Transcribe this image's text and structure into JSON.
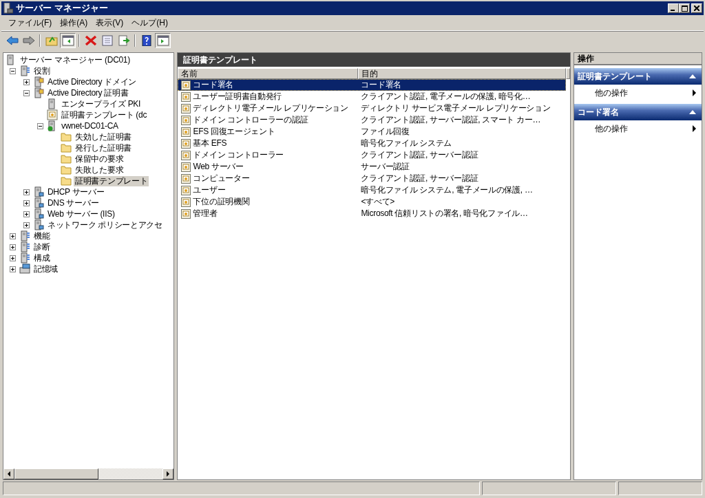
{
  "window": {
    "title": "サーバー マネージャー"
  },
  "menu": [
    "ファイル(F)",
    "操作(A)",
    "表示(V)",
    "ヘルプ(H)"
  ],
  "toolbar": [
    {
      "kind": "back"
    },
    {
      "kind": "forward"
    },
    {
      "kind": "separator"
    },
    {
      "kind": "up"
    },
    {
      "kind": "tree-toggle",
      "pressed": true
    },
    {
      "kind": "separator"
    },
    {
      "kind": "delete"
    },
    {
      "kind": "properties"
    },
    {
      "kind": "export"
    },
    {
      "kind": "separator"
    },
    {
      "kind": "help"
    },
    {
      "kind": "action-toggle",
      "pressed": true
    }
  ],
  "tree": [
    {
      "label": "サーバー マネージャー (DC01)",
      "kind": "server",
      "selected": false,
      "expanded": true,
      "children": [
        {
          "label": "役割",
          "kind": "roles",
          "selected": false,
          "expanded": true,
          "children": [
            {
              "label": "Active Directory ドメイン",
              "kind": "ad",
              "selected": false,
              "expanded": false
            },
            {
              "label": "Active Directory 証明書",
              "kind": "ad",
              "selected": false,
              "expanded": true,
              "children": [
                {
                  "label": "エンタープライズ PKI",
                  "kind": "server",
                  "selected": false
                },
                {
                  "label": "証明書テンプレート (dc",
                  "kind": "certificate",
                  "selected": false
                },
                {
                  "label": "vwnet-DC01-CA",
                  "kind": "ca",
                  "selected": false,
                  "expanded": true,
                  "children": [
                    {
                      "label": "失効した証明書",
                      "kind": "folder",
                      "selected": false
                    },
                    {
                      "label": "発行した証明書",
                      "kind": "folder",
                      "selected": false
                    },
                    {
                      "label": "保留中の要求",
                      "kind": "folder",
                      "selected": false
                    },
                    {
                      "label": "失敗した要求",
                      "kind": "folder",
                      "selected": false
                    },
                    {
                      "label": "証明書テンプレート",
                      "kind": "folder",
                      "selected": true
                    }
                  ]
                }
              ]
            },
            {
              "label": "DHCP サーバー",
              "kind": "network",
              "selected": false,
              "expanded": false
            },
            {
              "label": "DNS サーバー",
              "kind": "network",
              "selected": false,
              "expanded": false
            },
            {
              "label": "Web サーバー (IIS)",
              "kind": "network",
              "selected": false,
              "expanded": false
            },
            {
              "label": "ネットワーク ポリシーとアクセ",
              "kind": "network",
              "selected": false,
              "expanded": false
            }
          ]
        },
        {
          "label": "機能",
          "kind": "roles",
          "selected": false,
          "expanded": false
        },
        {
          "label": "診断",
          "kind": "roles",
          "selected": false,
          "expanded": false
        },
        {
          "label": "構成",
          "kind": "roles",
          "selected": false,
          "expanded": false
        },
        {
          "label": "記憶域",
          "kind": "storage",
          "selected": false,
          "expanded": false
        }
      ]
    }
  ],
  "content": {
    "title": "証明書テンプレート",
    "columns": [
      "名前",
      "目的"
    ],
    "rows": [
      {
        "name": "コード署名",
        "purpose": "コード署名",
        "selected": true
      },
      {
        "name": "ユーザー証明書自動発行",
        "purpose": "クライアント認証, 電子メールの保護, 暗号化…",
        "selected": false
      },
      {
        "name": "ディレクトリ電子メール レプリケーション",
        "purpose": "ディレクトリ サービス電子メール レプリケーション",
        "selected": false
      },
      {
        "name": "ドメイン コントローラーの認証",
        "purpose": "クライアント認証, サーバー認証, スマート カー…",
        "selected": false
      },
      {
        "name": "EFS 回復エージェント",
        "purpose": "ファイル回復",
        "selected": false
      },
      {
        "name": "基本 EFS",
        "purpose": "暗号化ファイル システム",
        "selected": false
      },
      {
        "name": "ドメイン コントローラー",
        "purpose": "クライアント認証, サーバー認証",
        "selected": false
      },
      {
        "name": "Web サーバー",
        "purpose": "サーバー認証",
        "selected": false
      },
      {
        "name": "コンピューター",
        "purpose": "クライアント認証, サーバー認証",
        "selected": false
      },
      {
        "name": "ユーザー",
        "purpose": "暗号化ファイル システム, 電子メールの保護, …",
        "selected": false
      },
      {
        "name": "下位の証明機関",
        "purpose": "<すべて>",
        "selected": false
      },
      {
        "name": "管理者",
        "purpose": "Microsoft 信頼リストの署名, 暗号化ファイル…",
        "selected": false
      }
    ]
  },
  "actions": {
    "title": "操作",
    "sections": [
      {
        "title": "証明書テンプレート",
        "expanded": true,
        "items": [
          "他の操作"
        ]
      },
      {
        "title": "コード署名",
        "expanded": true,
        "items": [
          "他の操作"
        ]
      }
    ]
  }
}
